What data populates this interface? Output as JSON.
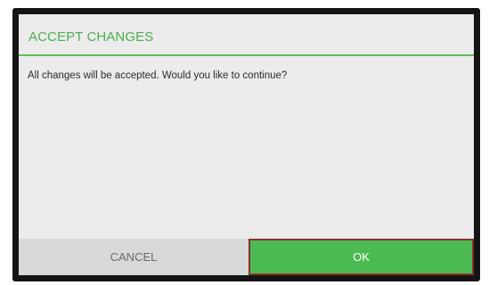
{
  "dialog": {
    "title": "ACCEPT CHANGES",
    "message": "All changes will be accepted. Would you like to continue?",
    "cancel_label": "CANCEL",
    "ok_label": "OK"
  },
  "colors": {
    "accent": "#4caf50",
    "ok_button_bg": "#4cba52",
    "ok_button_border": "#8b2f2f",
    "cancel_button_bg": "#d9d9d9",
    "dialog_bg": "#ececec",
    "frame_bg": "#141414"
  }
}
